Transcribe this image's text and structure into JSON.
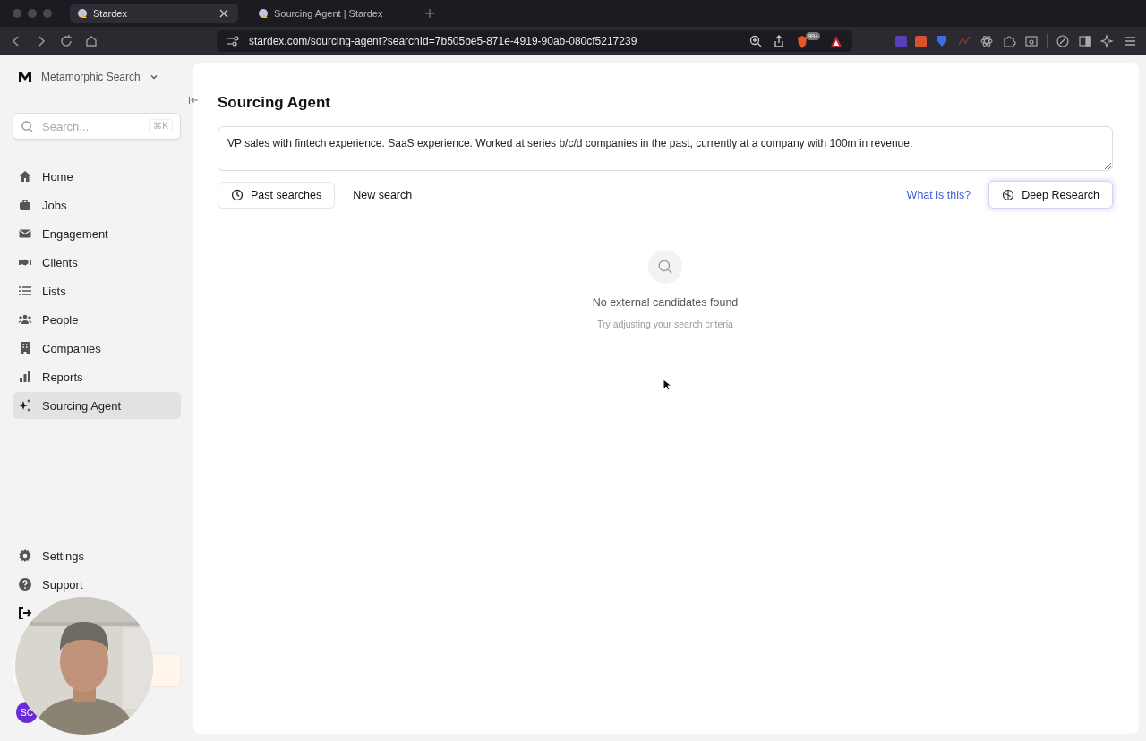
{
  "browser": {
    "tabs": [
      {
        "title": "Stardex",
        "selected": true
      },
      {
        "title": "Sourcing Agent | Stardex",
        "selected": false
      }
    ],
    "address": "stardex.com/sourcing-agent?searchId=7b505be5-871e-4919-90ab-080cf5217239",
    "shield_badge": "99+"
  },
  "sidebar": {
    "workspace": "Metamorphic Search",
    "search": {
      "placeholder": "Search...",
      "shortcut": "⌘K"
    },
    "items": [
      {
        "label": "Home",
        "selected": false
      },
      {
        "label": "Jobs",
        "selected": false
      },
      {
        "label": "Engagement",
        "selected": false
      },
      {
        "label": "Clients",
        "selected": false
      },
      {
        "label": "Lists",
        "selected": false
      },
      {
        "label": "People",
        "selected": false
      },
      {
        "label": "Companies",
        "selected": false
      },
      {
        "label": "Reports",
        "selected": false
      },
      {
        "label": "Sourcing Agent",
        "selected": true
      }
    ],
    "footer_items": [
      {
        "label": "Settings"
      },
      {
        "label": "Support"
      }
    ],
    "avatar": "SC"
  },
  "main": {
    "title": "Sourcing Agent",
    "query": "VP sales with fintech experience. SaaS experience. Worked at series b/c/d companies in the past, currently at a company with 100m in revenue.",
    "buttons": [
      {
        "label": "Past searches",
        "kind": "outlined"
      },
      {
        "label": "New search",
        "kind": "plain"
      }
    ],
    "help_link": "What is this?",
    "deep_research": "Deep Research",
    "empty_state": {
      "title": "No external candidates found",
      "hint": "Try adjusting your search criteria"
    }
  }
}
